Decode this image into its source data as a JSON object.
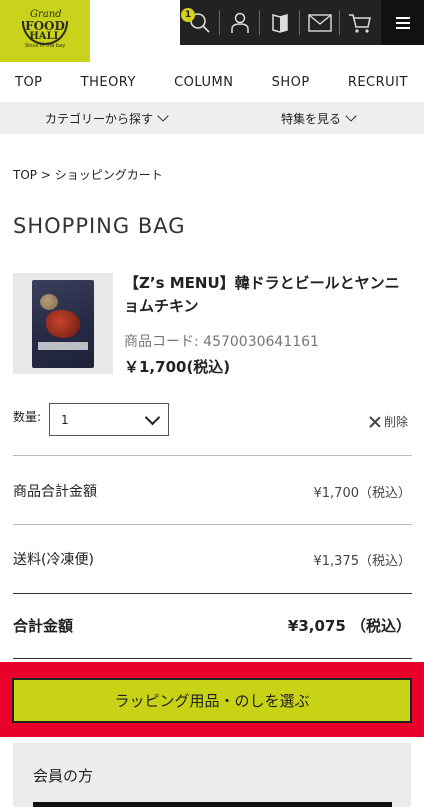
{
  "header": {
    "logo": {
      "line1": "Grand",
      "line2": "FOOD",
      "line3": "HALL",
      "tagline": "Since in the bay"
    },
    "icons": [
      "search-icon",
      "user-icon",
      "bookmark-icon",
      "mail-icon",
      "cart-icon"
    ],
    "cart_count": "1"
  },
  "nav": {
    "items": [
      "TOP",
      "THEORY",
      "COLUMN",
      "SHOP",
      "RECRUIT"
    ]
  },
  "subnav": {
    "category": "カテゴリーから探す",
    "feature": "特集を見る"
  },
  "breadcrumb": "TOP > ショッピングカート",
  "page_title": "SHOPPING BAG",
  "product": {
    "name": "【Z’s MENU】韓ドラとビールとヤンニョムチキン",
    "code": "商品コード: 4570030641161",
    "price": "￥1,700(税込)"
  },
  "quantity": {
    "label": "数量:",
    "value": "1"
  },
  "delete_label": "削除",
  "summary": {
    "subtotal_label": "商品合計金額",
    "subtotal_value": "¥1,700（税込）",
    "shipping_label": "送料(冷凍便)",
    "shipping_value": "¥1,375（税込）",
    "total_label": "合計金額",
    "total_value": "¥3,075 （税込）"
  },
  "cta": {
    "label": "ラッピング用品・のしを選ぶ"
  },
  "member": {
    "title": "会員の方"
  },
  "colors": {
    "brand": "#c9d31c",
    "header_dark": "#222222",
    "cta_bg": "#e8002b",
    "cta_button": "#c9d316"
  }
}
